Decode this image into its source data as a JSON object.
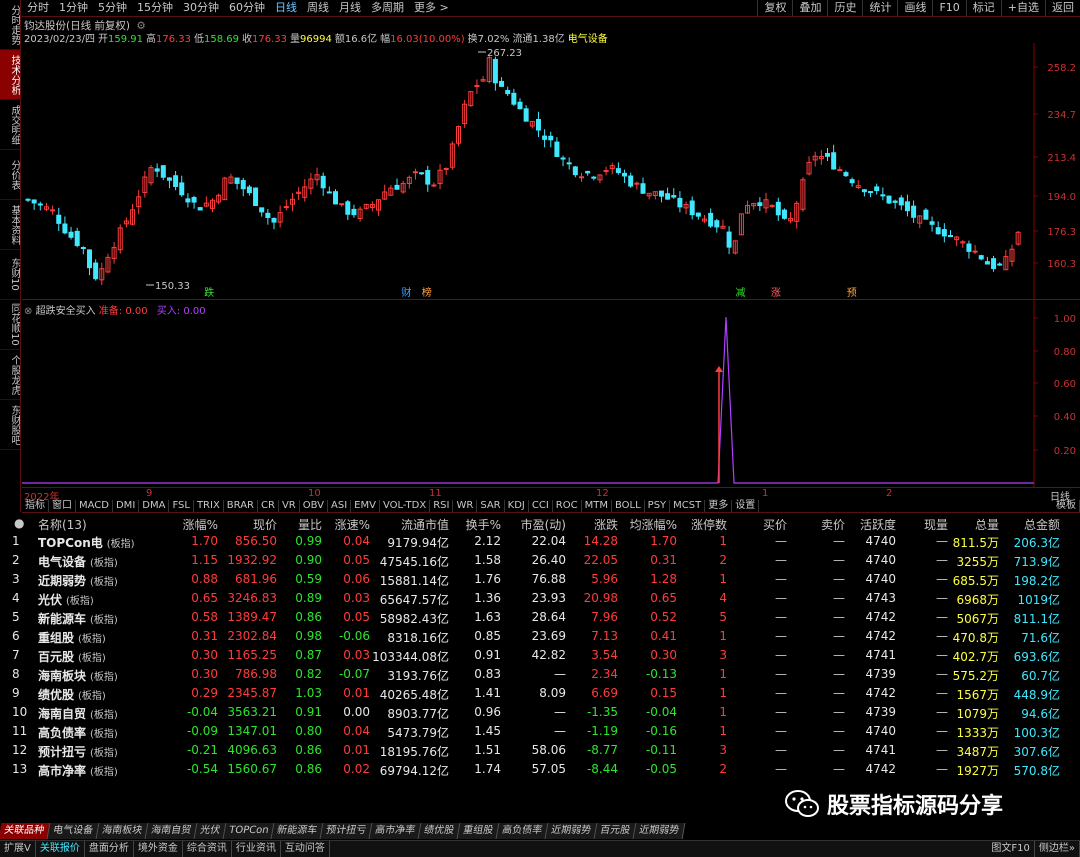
{
  "left_tabs": [
    "分时走势",
    "技术分析",
    "成交明细",
    "分价表",
    "基本资料",
    "东财10",
    "同花顺10",
    "个股龙虎",
    "东财股吧"
  ],
  "left_tab_active": 1,
  "toolbar": {
    "items": [
      "分时",
      "1分钟",
      "5分钟",
      "15分钟",
      "30分钟",
      "60分钟",
      "日线",
      "周线",
      "月线",
      "多周期",
      "更多 >"
    ],
    "active": 6,
    "right_items": [
      "复权",
      "叠加",
      "历史",
      "统计",
      "画线",
      "F10",
      "标记",
      "+自选",
      "返回"
    ]
  },
  "stock_title": "钧达股份(日线 前复权)",
  "quote": {
    "date": "2023/02/23/四",
    "open_label": "开",
    "open": "159.91",
    "high_label": "高",
    "high": "176.33",
    "low_label": "低",
    "low": "158.69",
    "close_label": "收",
    "close": "176.33",
    "vol_label": "量",
    "vol": "96994",
    "amt_label": "额",
    "amt": "16.6亿",
    "chg_label": "幅",
    "chg": "16.03(10.00%)",
    "turn_label": "换",
    "turn": "7.02%",
    "float_label": "流通",
    "float": "1.38亿",
    "sector": "电气设备"
  },
  "main_chart": {
    "y_ticks": [
      "258.2",
      "234.7",
      "213.4",
      "194.0",
      "176.3",
      "160.3"
    ],
    "high_note": "267.23",
    "low_note": "150.33",
    "markers": [
      {
        "text": "跌",
        "color": "#2ee62e",
        "x": 0.18
      },
      {
        "text": "财",
        "color": "#40a0ff",
        "x": 0.375
      },
      {
        "text": "榜",
        "color": "#ffa040",
        "x": 0.395
      },
      {
        "text": "减",
        "color": "#2ee62e",
        "x": 0.705
      },
      {
        "text": "涨",
        "color": "#ff6060",
        "x": 0.74
      },
      {
        "text": "预",
        "color": "#ffa040",
        "x": 0.815
      }
    ]
  },
  "indicator": {
    "name": "超跌安全买入",
    "field1_label": "准备: ",
    "field1_value": "0.00",
    "field2_label": "买入: ",
    "field2_value": "0.00",
    "y_ticks": [
      "1.00",
      "0.80",
      "0.60",
      "0.40",
      "0.20"
    ]
  },
  "date_axis": {
    "labels": [
      "2022年",
      "9",
      "10",
      "11",
      "12",
      "1",
      "2"
    ],
    "right": "日线"
  },
  "indicator_tabs": [
    "指标",
    "窗口",
    "MACD",
    "DMI",
    "DMA",
    "FSL",
    "TRIX",
    "BRAR",
    "CR",
    "VR",
    "OBV",
    "ASI",
    "EMV",
    "VOL-TDX",
    "RSI",
    "WR",
    "SAR",
    "KDJ",
    "CCI",
    "ROC",
    "MTM",
    "BOLL",
    "PSY",
    "MCST",
    "更多",
    "设置"
  ],
  "indicator_tabs_right": "模板",
  "table": {
    "headers": [
      "名称(13)",
      "涨幅%",
      "现价",
      "量比",
      "涨速%",
      "流通市值",
      "换手%",
      "市盈(动)",
      "涨跌",
      "均涨幅%",
      "涨停数",
      "买价",
      "卖价",
      "活跃度",
      "现量",
      "总量",
      "总金额"
    ],
    "rows": [
      {
        "n": "1",
        "name": "TOPCon电",
        "tag": "(板指)",
        "chg": "1.70",
        "price": "856.50",
        "vr": "0.99",
        "spd": "0.04",
        "mcap": "9179.94亿",
        "turn": "2.12",
        "pe": "22.04",
        "diff": "14.28",
        "avg": "1.70",
        "lu": "1",
        "bid": "—",
        "ask": "—",
        "act": "4740",
        "cur": "—",
        "vol": "811.5万",
        "amt": "206.3亿",
        "c": "r"
      },
      {
        "n": "2",
        "name": "电气设备",
        "tag": "(板指)",
        "chg": "1.15",
        "price": "1932.92",
        "vr": "0.90",
        "spd": "0.05",
        "mcap": "47545.16亿",
        "turn": "1.58",
        "pe": "26.40",
        "diff": "22.05",
        "avg": "0.31",
        "lu": "2",
        "bid": "—",
        "ask": "—",
        "act": "4740",
        "cur": "—",
        "vol": "3255万",
        "amt": "713.9亿",
        "c": "r"
      },
      {
        "n": "3",
        "name": "近期弱势",
        "tag": "(板指)",
        "chg": "0.88",
        "price": "681.96",
        "vr": "0.59",
        "spd": "0.06",
        "mcap": "15881.14亿",
        "turn": "1.76",
        "pe": "76.88",
        "diff": "5.96",
        "avg": "1.28",
        "lu": "1",
        "bid": "—",
        "ask": "—",
        "act": "4740",
        "cur": "—",
        "vol": "685.5万",
        "amt": "198.2亿",
        "c": "r"
      },
      {
        "n": "4",
        "name": "光伏",
        "tag": "(板指)",
        "chg": "0.65",
        "price": "3246.83",
        "vr": "0.89",
        "spd": "0.03",
        "mcap": "65647.57亿",
        "turn": "1.36",
        "pe": "23.93",
        "diff": "20.98",
        "avg": "0.65",
        "lu": "4",
        "bid": "—",
        "ask": "—",
        "act": "4743",
        "cur": "—",
        "vol": "6968万",
        "amt": "1019亿",
        "c": "r"
      },
      {
        "n": "5",
        "name": "新能源车",
        "tag": "(板指)",
        "chg": "0.58",
        "price": "1389.47",
        "vr": "0.86",
        "spd": "0.05",
        "mcap": "58982.43亿",
        "turn": "1.63",
        "pe": "28.64",
        "diff": "7.96",
        "avg": "0.52",
        "lu": "5",
        "bid": "—",
        "ask": "—",
        "act": "4742",
        "cur": "—",
        "vol": "5067万",
        "amt": "811.1亿",
        "c": "r"
      },
      {
        "n": "6",
        "name": "重组股",
        "tag": "(板指)",
        "chg": "0.31",
        "price": "2302.84",
        "vr": "0.98",
        "spd": "-0.06",
        "mcap": "8318.16亿",
        "turn": "0.85",
        "pe": "23.69",
        "diff": "7.13",
        "avg": "0.41",
        "lu": "1",
        "bid": "—",
        "ask": "—",
        "act": "4742",
        "cur": "—",
        "vol": "470.8万",
        "amt": "71.6亿",
        "c": "r"
      },
      {
        "n": "7",
        "name": "百元股",
        "tag": "(板指)",
        "chg": "0.30",
        "price": "1165.25",
        "vr": "0.87",
        "spd": "0.03",
        "mcap": "103344.08亿",
        "turn": "0.91",
        "pe": "42.82",
        "diff": "3.54",
        "avg": "0.30",
        "lu": "3",
        "bid": "—",
        "ask": "—",
        "act": "4741",
        "cur": "—",
        "vol": "402.7万",
        "amt": "693.6亿",
        "c": "r"
      },
      {
        "n": "8",
        "name": "海南板块",
        "tag": "(板指)",
        "chg": "0.30",
        "price": "786.98",
        "vr": "0.82",
        "spd": "-0.07",
        "mcap": "3193.76亿",
        "turn": "0.83",
        "pe": "—",
        "diff": "2.34",
        "avg": "-0.13",
        "lu": "1",
        "bid": "—",
        "ask": "—",
        "act": "4739",
        "cur": "—",
        "vol": "575.2万",
        "amt": "60.7亿",
        "c": "r"
      },
      {
        "n": "9",
        "name": "绩优股",
        "tag": "(板指)",
        "chg": "0.29",
        "price": "2345.87",
        "vr": "1.03",
        "spd": "0.01",
        "mcap": "40265.48亿",
        "turn": "1.41",
        "pe": "8.09",
        "diff": "6.69",
        "avg": "0.15",
        "lu": "1",
        "bid": "—",
        "ask": "—",
        "act": "4742",
        "cur": "—",
        "vol": "1567万",
        "amt": "448.9亿",
        "c": "r"
      },
      {
        "n": "10",
        "name": "海南自贸",
        "tag": "(板指)",
        "chg": "-0.04",
        "price": "3563.21",
        "vr": "0.91",
        "spd": "0.00",
        "mcap": "8903.77亿",
        "turn": "0.96",
        "pe": "—",
        "diff": "-1.35",
        "avg": "-0.04",
        "lu": "1",
        "bid": "—",
        "ask": "—",
        "act": "4739",
        "cur": "—",
        "vol": "1079万",
        "amt": "94.6亿",
        "c": "g"
      },
      {
        "n": "11",
        "name": "高负债率",
        "tag": "(板指)",
        "chg": "-0.09",
        "price": "1347.01",
        "vr": "0.80",
        "spd": "0.04",
        "mcap": "5473.79亿",
        "turn": "1.45",
        "pe": "—",
        "diff": "-1.19",
        "avg": "-0.16",
        "lu": "1",
        "bid": "—",
        "ask": "—",
        "act": "4740",
        "cur": "—",
        "vol": "1333万",
        "amt": "100.3亿",
        "c": "g"
      },
      {
        "n": "12",
        "name": "预计扭亏",
        "tag": "(板指)",
        "chg": "-0.21",
        "price": "4096.63",
        "vr": "0.86",
        "spd": "0.01",
        "mcap": "18195.76亿",
        "turn": "1.51",
        "pe": "58.06",
        "diff": "-8.77",
        "avg": "-0.11",
        "lu": "3",
        "bid": "—",
        "ask": "—",
        "act": "4741",
        "cur": "—",
        "vol": "3487万",
        "amt": "307.6亿",
        "c": "g"
      },
      {
        "n": "13",
        "name": "高市净率",
        "tag": "(板指)",
        "chg": "-0.54",
        "price": "1560.67",
        "vr": "0.86",
        "spd": "0.02",
        "mcap": "69794.12亿",
        "turn": "1.74",
        "pe": "57.05",
        "diff": "-8.44",
        "avg": "-0.05",
        "lu": "2",
        "bid": "—",
        "ask": "—",
        "act": "4742",
        "cur": "—",
        "vol": "1927万",
        "amt": "570.8亿",
        "c": "g"
      }
    ]
  },
  "bottom_tabs": [
    "关联品种",
    "电气设备",
    "海南板块",
    "海南自贸",
    "光伏",
    "TOPCon",
    "新能源车",
    "预计扭亏",
    "高市净率",
    "绩优股",
    "重组股",
    "高负债率",
    "近期弱势",
    "百元股",
    "近期弱势"
  ],
  "status_bar": [
    "扩展V",
    "关联报价",
    "盘面分析",
    "境外资金",
    "综合资讯",
    "行业资讯",
    "互动问答"
  ],
  "status_bar_active": 1,
  "status_bar_right": [
    "图文F10",
    "侧边栏»"
  ],
  "watermark": "股票指标源码分享",
  "colors": {
    "up": "#ff3c3c",
    "down": "#40e8ff",
    "accent": "#8b0000",
    "indicator": "#b040ff"
  }
}
